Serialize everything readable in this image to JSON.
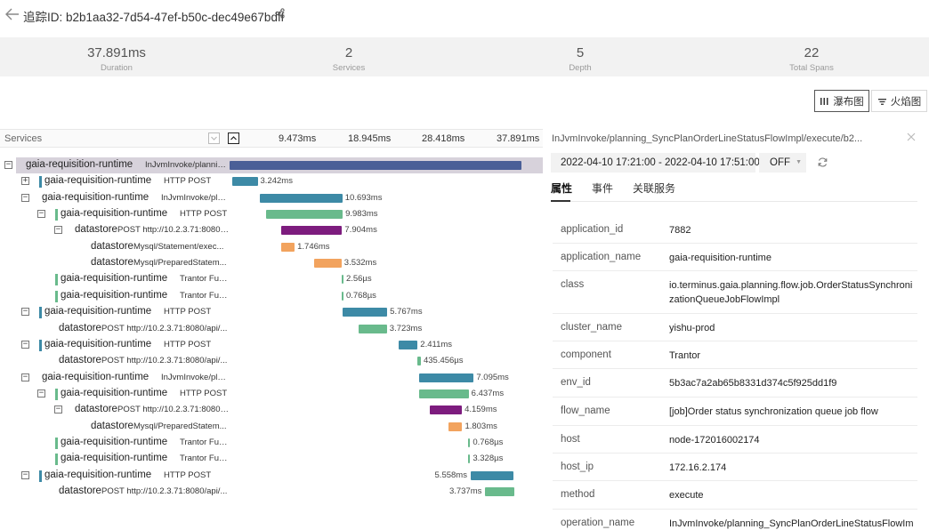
{
  "header": {
    "title": "追踪ID: b2b1aa32-7d54-47ef-b50c-dec49e67bdff",
    "back_icon": "arrow-left-icon",
    "share_icon": "share-icon"
  },
  "stats": [
    {
      "value": "37.891ms",
      "label": "Duration"
    },
    {
      "value": "2",
      "label": "Services"
    },
    {
      "value": "5",
      "label": "Depth"
    },
    {
      "value": "22",
      "label": "Total Spans"
    }
  ],
  "view_toggle": {
    "waterfall": "瀑布图",
    "flame": "火焰图"
  },
  "timeline": {
    "services_label": "Services",
    "ticks": [
      "9.473ms",
      "18.945ms",
      "28.418ms",
      "37.891ms"
    ]
  },
  "spans": [
    {
      "service": "gaia-requisition-runtime",
      "op": "InJvmInvoke/planning_Sy...",
      "duration": "",
      "start_ms": 0.0,
      "dur_ms": 37.891,
      "color": "#4a5f97",
      "depth": 0,
      "expander": "minus"
    },
    {
      "service": "gaia-requisition-runtime",
      "op": "HTTP POST",
      "duration": "3.242ms",
      "start_ms": 0.4,
      "dur_ms": 3.242,
      "color": "#3d8aa6",
      "depth": 1,
      "expander": "plus"
    },
    {
      "service": "gaia-requisition-runtime",
      "op": "InJvmInvoke/plannin...",
      "duration": "10.693ms",
      "start_ms": 3.95,
      "dur_ms": 10.693,
      "color": "#3d8aa6",
      "depth": 1,
      "expander": "minus"
    },
    {
      "service": "gaia-requisition-runtime",
      "op": "HTTP POST",
      "duration": "9.983ms",
      "start_ms": 4.7,
      "dur_ms": 9.983,
      "color": "#69ba8c",
      "depth": 2,
      "expander": "minus"
    },
    {
      "service": "datastore",
      "op": "POST http://10.2.3.71:8080/...",
      "duration": "7.904ms",
      "start_ms": 6.7,
      "dur_ms": 7.904,
      "color": "#7d1c7e",
      "depth": 3,
      "expander": "minus"
    },
    {
      "service": "datastore",
      "op": "Mysql/Statement/exec...",
      "duration": "1.746ms",
      "start_ms": 6.7,
      "dur_ms": 1.746,
      "color": "#f2a35e",
      "depth": 4,
      "expander": ""
    },
    {
      "service": "datastore",
      "op": "Mysql/PreparedStatem...",
      "duration": "3.532ms",
      "start_ms": 11.0,
      "dur_ms": 3.532,
      "color": "#f2a35e",
      "depth": 4,
      "expander": ""
    },
    {
      "service": "gaia-requisition-runtime",
      "op": "Trantor Function",
      "duration": "2.56µs",
      "start_ms": 14.55,
      "dur_ms": 0.05,
      "color": "#69ba8c",
      "depth": 2,
      "expander": ""
    },
    {
      "service": "gaia-requisition-runtime",
      "op": "Trantor Function",
      "duration": "0.768µs",
      "start_ms": 14.55,
      "dur_ms": 0.05,
      "color": "#69ba8c",
      "depth": 2,
      "expander": ""
    },
    {
      "service": "gaia-requisition-runtime",
      "op": "HTTP POST",
      "duration": "5.767ms",
      "start_ms": 14.7,
      "dur_ms": 5.767,
      "color": "#3d8aa6",
      "depth": 1,
      "expander": "minus"
    },
    {
      "service": "datastore",
      "op": "POST http://10.2.3.71:8080/api/...",
      "duration": "3.723ms",
      "start_ms": 16.7,
      "dur_ms": 3.723,
      "color": "#69ba8c",
      "depth": 2,
      "expander": ""
    },
    {
      "service": "gaia-requisition-runtime",
      "op": "HTTP POST",
      "duration": "2.411ms",
      "start_ms": 22.0,
      "dur_ms": 2.411,
      "color": "#3d8aa6",
      "depth": 1,
      "expander": "minus"
    },
    {
      "service": "datastore",
      "op": "POST http://10.2.3.71:8080/api/...",
      "duration": "435.456µs",
      "start_ms": 24.4,
      "dur_ms": 0.435,
      "color": "#69ba8c",
      "depth": 2,
      "expander": ""
    },
    {
      "service": "gaia-requisition-runtime",
      "op": "InJvmInvoke/plannin...",
      "duration": "7.095ms",
      "start_ms": 24.6,
      "dur_ms": 7.095,
      "color": "#3d8aa6",
      "depth": 1,
      "expander": "minus"
    },
    {
      "service": "gaia-requisition-runtime",
      "op": "HTTP POST",
      "duration": "6.437ms",
      "start_ms": 24.6,
      "dur_ms": 6.437,
      "color": "#69ba8c",
      "depth": 2,
      "expander": "minus"
    },
    {
      "service": "datastore",
      "op": "POST http://10.2.3.71:8080/...",
      "duration": "4.159ms",
      "start_ms": 26.0,
      "dur_ms": 4.159,
      "color": "#7d1c7e",
      "depth": 3,
      "expander": "minus"
    },
    {
      "service": "datastore",
      "op": "Mysql/PreparedStatem...",
      "duration": "1.803ms",
      "start_ms": 28.4,
      "dur_ms": 1.803,
      "color": "#f2a35e",
      "depth": 4,
      "expander": ""
    },
    {
      "service": "gaia-requisition-runtime",
      "op": "Trantor Function",
      "duration": "0.768µs",
      "start_ms": 31.0,
      "dur_ms": 0.05,
      "color": "#69ba8c",
      "depth": 2,
      "expander": ""
    },
    {
      "service": "gaia-requisition-runtime",
      "op": "Trantor Function",
      "duration": "3.328µs",
      "start_ms": 31.0,
      "dur_ms": 0.05,
      "color": "#69ba8c",
      "depth": 2,
      "expander": ""
    },
    {
      "service": "gaia-requisition-runtime",
      "op": "HTTP POST",
      "duration": "5.558ms",
      "start_ms": 31.3,
      "dur_ms": 5.558,
      "color": "#3d8aa6",
      "depth": 1,
      "expander": "minus"
    },
    {
      "service": "datastore",
      "op": "POST http://10.2.3.71:8080/api/...",
      "duration": "3.737ms",
      "start_ms": 33.2,
      "dur_ms": 3.737,
      "color": "#69ba8c",
      "depth": 2,
      "expander": ""
    }
  ],
  "detail": {
    "title": "InJvmInvoke/planning_SyncPlanOrderLineStatusFlowImpl/execute/b2...",
    "time_range": "2022-04-10 17:21:00 - 2022-04-10 17:51:00",
    "off_label": "OFF",
    "tabs": [
      "属性",
      "事件",
      "关联服务"
    ],
    "attributes": [
      {
        "key": "application_id",
        "value": "7882"
      },
      {
        "key": "application_name",
        "value": "gaia-requisition-runtime"
      },
      {
        "key": "class",
        "value": "io.terminus.gaia.planning.flow.job.OrderStatusSynchronizationQueueJobFlowImpl"
      },
      {
        "key": "cluster_name",
        "value": "yishu-prod"
      },
      {
        "key": "component",
        "value": "Trantor"
      },
      {
        "key": "env_id",
        "value": "5b3ac7a2ab65b8331d374c5f925dd1f9"
      },
      {
        "key": "flow_name",
        "value": "[job]Order status synchronization queue job flow"
      },
      {
        "key": "host",
        "value": "node-172016002174"
      },
      {
        "key": "host_ip",
        "value": "172.16.2.174"
      },
      {
        "key": "method",
        "value": "execute"
      },
      {
        "key": "operation_name",
        "value": "InJvmInvoke/planning_SyncPlanOrderLineStatusFlowIm"
      }
    ]
  }
}
